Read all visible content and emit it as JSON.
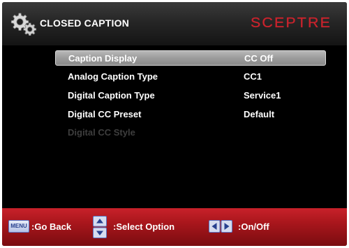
{
  "header": {
    "title": "CLOSED CAPTION",
    "brand": "SCEPTRE",
    "brand_color": "#c8232c"
  },
  "menu": {
    "items": [
      {
        "label": "Caption Display",
        "value": "CC Off",
        "selected": true,
        "enabled": true
      },
      {
        "label": "Analog Caption Type",
        "value": "CC1",
        "selected": false,
        "enabled": true
      },
      {
        "label": "Digital Caption Type",
        "value": "Service1",
        "selected": false,
        "enabled": true
      },
      {
        "label": "Digital CC Preset",
        "value": "Default",
        "selected": false,
        "enabled": true
      },
      {
        "label": "Digital CC Style",
        "value": "",
        "selected": false,
        "enabled": false
      }
    ]
  },
  "footer": {
    "menu_key": "MENU",
    "go_back": ":Go Back",
    "select_option": ":Select Option",
    "on_off": ":On/Off",
    "icons": [
      "menu-key-icon",
      "up-down-arrow-icon",
      "left-right-arrow-icon"
    ]
  }
}
